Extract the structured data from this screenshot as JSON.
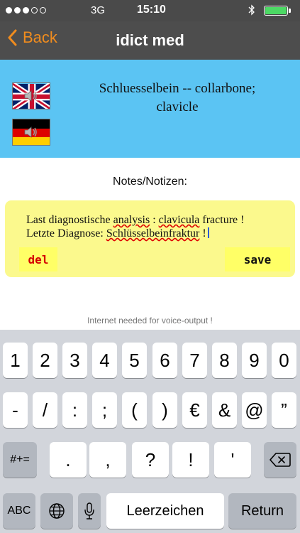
{
  "status_bar": {
    "carrier": "3G",
    "time": "15:10",
    "bluetooth_icon": "bluetooth-icon",
    "battery_level": 1.0,
    "signal_dots_filled": 3,
    "signal_dots_total": 5
  },
  "nav": {
    "back_label": "Back",
    "title": "idict med",
    "accent_color": "#f08c1e"
  },
  "term": {
    "line1": "Schluesselbein -- collarbone;",
    "line2": "clavicle",
    "flag_en_icon": "uk-flag-speaker-icon",
    "flag_de_icon": "german-flag-speaker-icon",
    "panel_color": "#5bc4f3"
  },
  "notes": {
    "label": "Notes/Notizen:",
    "line1_a": "Last diagnostische ",
    "line1_b": "analysis",
    "line1_c": " : ",
    "line1_d": "clavicula",
    "line1_e": " fracture !",
    "line2_a": "Letzte Diagnose: ",
    "line2_b": "Schlüsselbeinfraktur",
    "line2_c": " !",
    "del_label": "del",
    "save_label": "save",
    "box_color": "#fbf98d"
  },
  "hint": "Internet needed for voice-output !",
  "keyboard": {
    "row1": [
      "1",
      "2",
      "3",
      "4",
      "5",
      "6",
      "7",
      "8",
      "9",
      "0"
    ],
    "row2": [
      "-",
      "/",
      ":",
      ";",
      "(",
      ")",
      "€",
      "&",
      "@",
      "”"
    ],
    "row3": [
      "#+=",
      ".",
      ",",
      "?",
      "!",
      "'"
    ],
    "row4": [
      "ABC",
      "Leerzeichen",
      "Return"
    ],
    "icons": [
      "backspace-icon",
      "globe-icon",
      "microphone-icon"
    ]
  }
}
